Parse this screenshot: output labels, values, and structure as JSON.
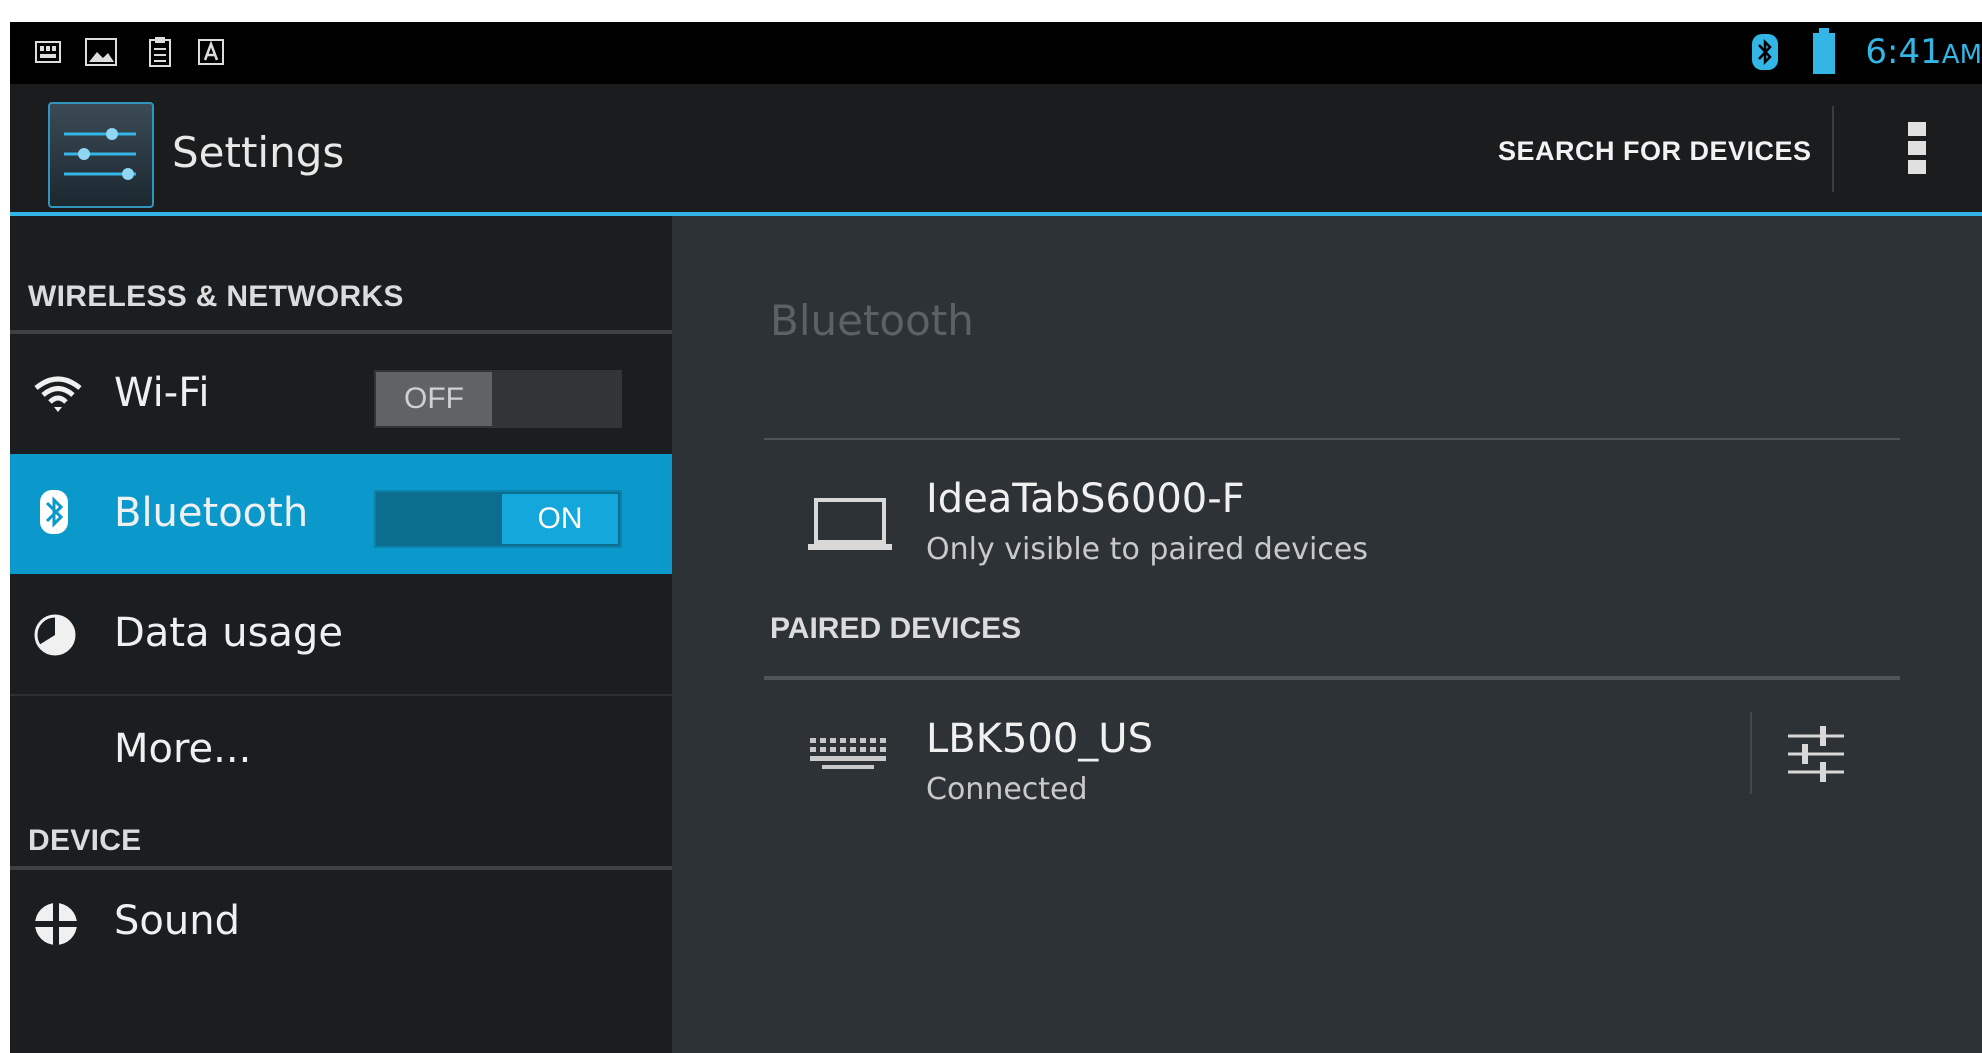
{
  "status_bar": {
    "notification_icons": [
      "sd-card-icon",
      "gallery-icon",
      "clipboard-icon",
      "keyboard-a-icon"
    ],
    "status_icons": [
      "bluetooth-icon",
      "battery-icon"
    ],
    "time": "6:41",
    "ampm": "AM"
  },
  "action_bar": {
    "title": "Settings",
    "search_label": "SEARCH FOR DEVICES"
  },
  "sidebar": {
    "section_wireless": "WIRELESS & NETWORKS",
    "wifi": {
      "label": "Wi-Fi",
      "toggle": "OFF",
      "icon": "wifi-icon"
    },
    "bluetooth": {
      "label": "Bluetooth",
      "toggle": "ON",
      "icon": "bluetooth-icon"
    },
    "data_usage": {
      "label": "Data usage",
      "icon": "data-usage-icon"
    },
    "more": {
      "label": "More..."
    },
    "section_device": "DEVICE",
    "sound": {
      "label": "Sound",
      "icon": "sound-icon"
    }
  },
  "main": {
    "title": "Bluetooth",
    "this_device": {
      "name": "IdeaTabS6000-F",
      "status": "Only visible to paired devices",
      "icon": "laptop-icon"
    },
    "paired_header": "PAIRED DEVICES",
    "paired_devices": [
      {
        "name": "LBK500_US",
        "status": "Connected",
        "icon": "keyboard-icon",
        "action_icon": "settings-sliders-icon"
      }
    ]
  },
  "colors": {
    "accent": "#33b5e5",
    "selected_row": "#0b99cc",
    "pane_bg": "#2c3235",
    "sidebar_bg": "#1b1e20"
  }
}
